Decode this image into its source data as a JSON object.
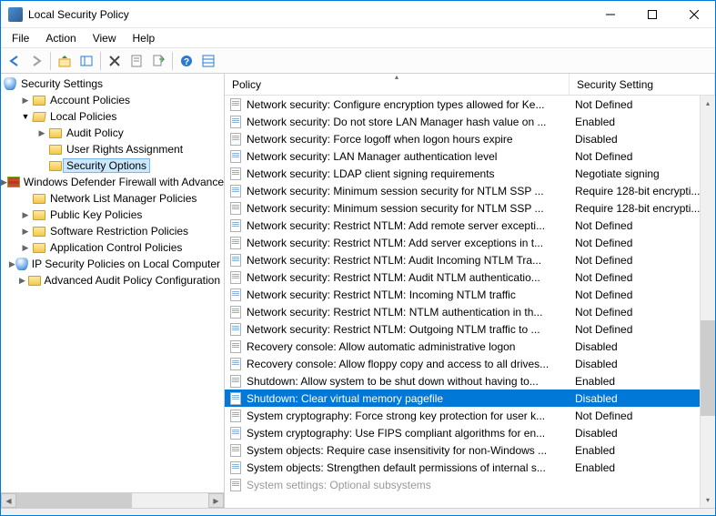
{
  "window": {
    "title": "Local Security Policy"
  },
  "menus": [
    "File",
    "Action",
    "View",
    "Help"
  ],
  "tree": {
    "root_label": "Security Settings",
    "nodes": [
      {
        "label": "Account Policies",
        "depth": 1,
        "expander": "right",
        "icon": "folder"
      },
      {
        "label": "Local Policies",
        "depth": 1,
        "expander": "down",
        "icon": "folder-open"
      },
      {
        "label": "Audit Policy",
        "depth": 2,
        "expander": "right",
        "icon": "folder"
      },
      {
        "label": "User Rights Assignment",
        "depth": 2,
        "expander": "none",
        "icon": "folder"
      },
      {
        "label": "Security Options",
        "depth": 2,
        "expander": "none",
        "icon": "folder",
        "selected": true
      },
      {
        "label": "Windows Defender Firewall with Advanced Security",
        "depth": 1,
        "expander": "right",
        "icon": "firewall"
      },
      {
        "label": "Network List Manager Policies",
        "depth": 1,
        "expander": "none",
        "icon": "folder"
      },
      {
        "label": "Public Key Policies",
        "depth": 1,
        "expander": "right",
        "icon": "folder"
      },
      {
        "label": "Software Restriction Policies",
        "depth": 1,
        "expander": "right",
        "icon": "folder"
      },
      {
        "label": "Application Control Policies",
        "depth": 1,
        "expander": "right",
        "icon": "folder"
      },
      {
        "label": "IP Security Policies on Local Computer",
        "depth": 1,
        "expander": "right",
        "icon": "shield"
      },
      {
        "label": "Advanced Audit Policy Configuration",
        "depth": 1,
        "expander": "right",
        "icon": "folder"
      }
    ]
  },
  "list": {
    "columns": {
      "policy": "Policy",
      "setting": "Security Setting"
    },
    "rows": [
      {
        "policy": "Network security: Configure encryption types allowed for Ke...",
        "setting": "Not Defined"
      },
      {
        "policy": "Network security: Do not store LAN Manager hash value on ...",
        "setting": "Enabled"
      },
      {
        "policy": "Network security: Force logoff when logon hours expire",
        "setting": "Disabled"
      },
      {
        "policy": "Network security: LAN Manager authentication level",
        "setting": "Not Defined"
      },
      {
        "policy": "Network security: LDAP client signing requirements",
        "setting": "Negotiate signing"
      },
      {
        "policy": "Network security: Minimum session security for NTLM SSP ...",
        "setting": "Require 128-bit encrypti..."
      },
      {
        "policy": "Network security: Minimum session security for NTLM SSP ...",
        "setting": "Require 128-bit encrypti..."
      },
      {
        "policy": "Network security: Restrict NTLM: Add remote server excepti...",
        "setting": "Not Defined"
      },
      {
        "policy": "Network security: Restrict NTLM: Add server exceptions in t...",
        "setting": "Not Defined"
      },
      {
        "policy": "Network security: Restrict NTLM: Audit Incoming NTLM Tra...",
        "setting": "Not Defined"
      },
      {
        "policy": "Network security: Restrict NTLM: Audit NTLM authenticatio...",
        "setting": "Not Defined"
      },
      {
        "policy": "Network security: Restrict NTLM: Incoming NTLM traffic",
        "setting": "Not Defined"
      },
      {
        "policy": "Network security: Restrict NTLM: NTLM authentication in th...",
        "setting": "Not Defined"
      },
      {
        "policy": "Network security: Restrict NTLM: Outgoing NTLM traffic to ...",
        "setting": "Not Defined"
      },
      {
        "policy": "Recovery console: Allow automatic administrative logon",
        "setting": "Disabled"
      },
      {
        "policy": "Recovery console: Allow floppy copy and access to all drives...",
        "setting": "Disabled"
      },
      {
        "policy": "Shutdown: Allow system to be shut down without having to...",
        "setting": "Enabled"
      },
      {
        "policy": "Shutdown: Clear virtual memory pagefile",
        "setting": "Disabled",
        "selected": true
      },
      {
        "policy": "System cryptography: Force strong key protection for user k...",
        "setting": "Not Defined"
      },
      {
        "policy": "System cryptography: Use FIPS compliant algorithms for en...",
        "setting": "Disabled"
      },
      {
        "policy": "System objects: Require case insensitivity for non-Windows ...",
        "setting": "Enabled"
      },
      {
        "policy": "System objects: Strengthen default permissions of internal s...",
        "setting": "Enabled"
      },
      {
        "policy": "System settings: Optional subsystems",
        "setting": "",
        "faded": true
      }
    ]
  }
}
